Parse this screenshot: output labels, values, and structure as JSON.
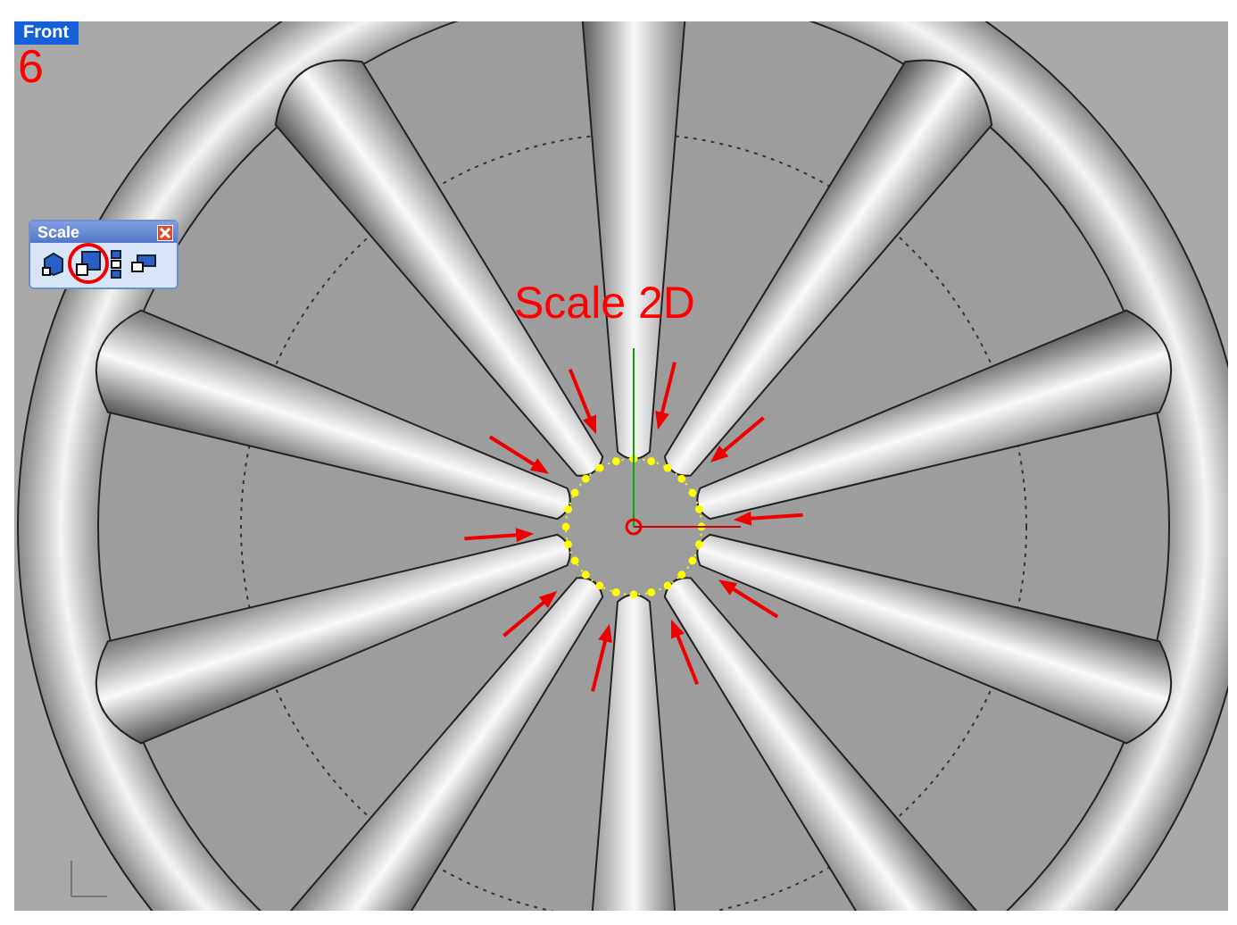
{
  "viewport": {
    "label": "Front",
    "step_number": "6",
    "annotation": "Scale 2D"
  },
  "toolbar": {
    "title": "Scale",
    "buttons": [
      {
        "kind": "scale3d",
        "selected": false
      },
      {
        "kind": "scale2d",
        "selected": true
      },
      {
        "kind": "scale1d",
        "selected": false
      },
      {
        "kind": "nonuniform",
        "selected": false
      }
    ]
  }
}
